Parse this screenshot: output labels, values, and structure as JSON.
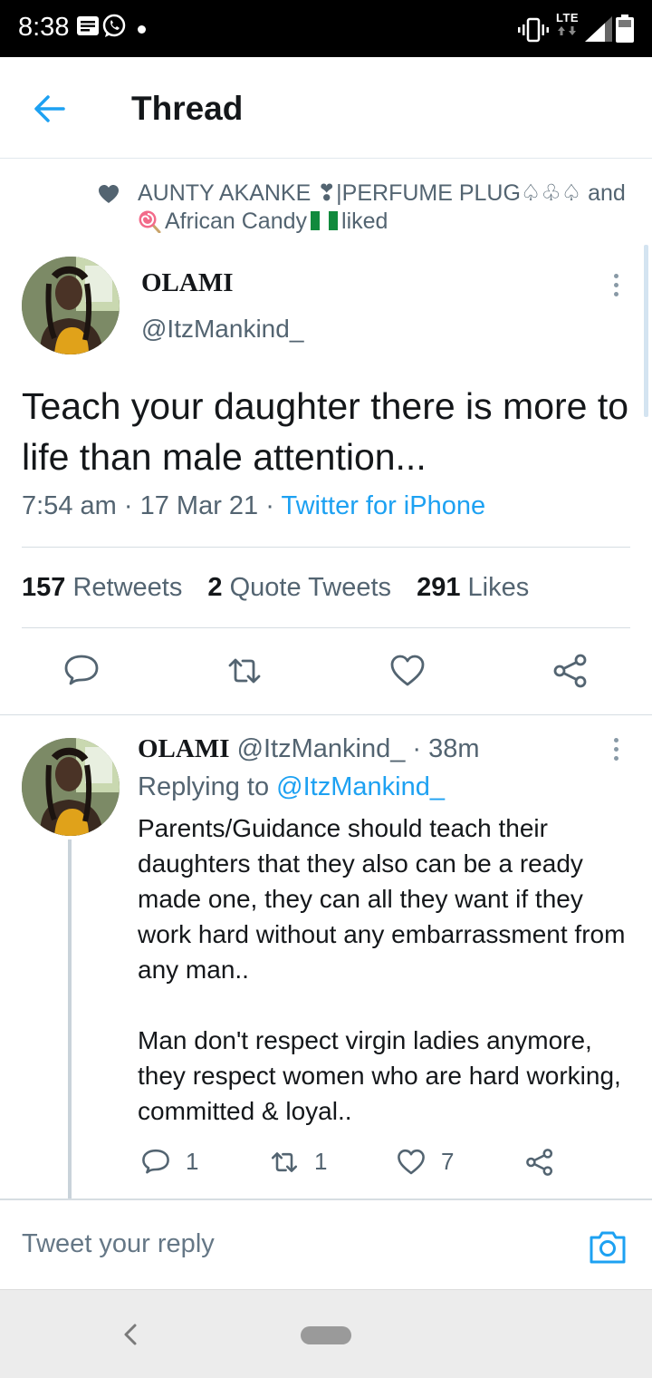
{
  "status_bar": {
    "time": "8:38",
    "network": "LTE"
  },
  "header": {
    "title": "Thread"
  },
  "liked_by": {
    "text_1": "AUNTY AKANKE ❣|PERFUME PLUG♤♧♤ and",
    "text_2": "African Candy",
    "text_3": "liked"
  },
  "main_tweet": {
    "author_name": "OLAMI",
    "author_handle": "@ItzMankind_",
    "text": "Teach your daughter there is more to life than male attention...",
    "time": "7:54 am",
    "date": "17 Mar 21",
    "source": "Twitter for iPhone",
    "stats": {
      "retweets_count": "157",
      "retweets_label": "Retweets",
      "quotes_count": "2",
      "quotes_label": "Quote Tweets",
      "likes_count": "291",
      "likes_label": "Likes"
    }
  },
  "reply_tweet": {
    "author_name": "OLAMI",
    "author_handle": "@ItzMankind_",
    "age": "38m",
    "replying_label": "Replying to",
    "replying_to": "@ItzMankind_",
    "paragraph_1": "Parents/Guidance should teach their daughters that they also can be a ready made one, they can all they want if they work hard without any embarrassment from any man..",
    "paragraph_2": "Man don't respect virgin ladies anymore, they respect women who are hard working, committed & loyal..",
    "reply_count": "1",
    "retweet_count": "1",
    "like_count": "7"
  },
  "composer": {
    "placeholder": "Tweet your reply"
  },
  "colors": {
    "accent": "#1da1f2",
    "secondary_text": "#536471",
    "primary_text": "#14171a"
  }
}
